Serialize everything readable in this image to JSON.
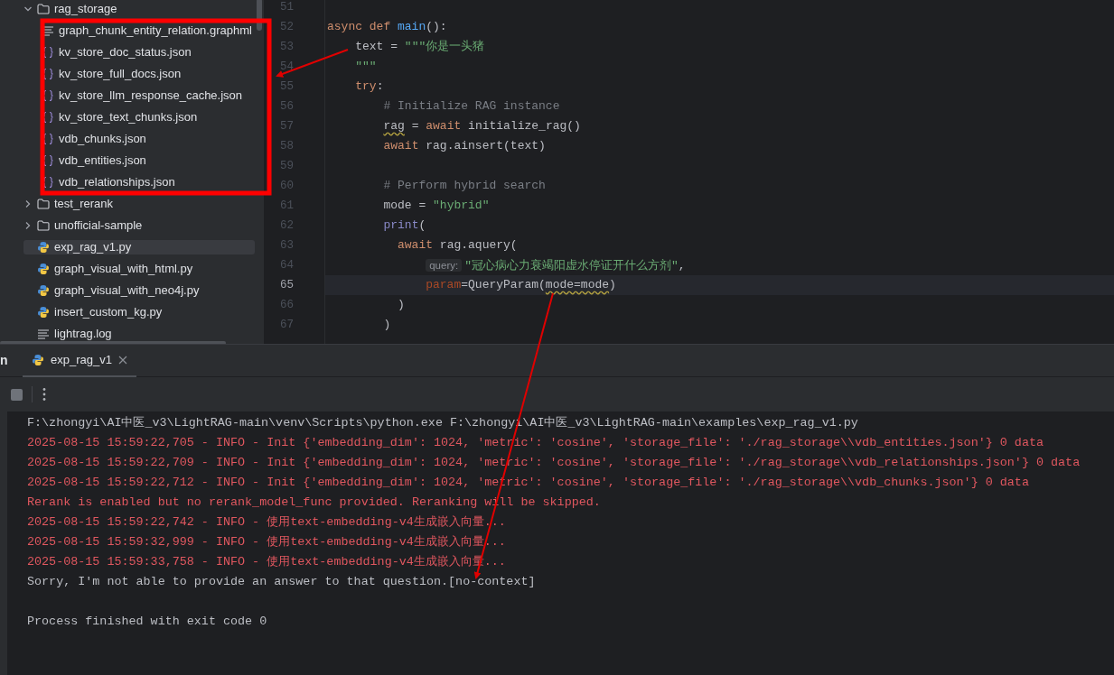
{
  "project_tree": [
    {
      "label": "rag_storage",
      "kind": "folder",
      "expanded": true,
      "selected": false,
      "children": [
        {
          "label": "graph_chunk_entity_relation.graphml",
          "kind": "text",
          "selected": false
        },
        {
          "label": "kv_store_doc_status.json",
          "kind": "json",
          "selected": false
        },
        {
          "label": "kv_store_full_docs.json",
          "kind": "json",
          "selected": false
        },
        {
          "label": "kv_store_llm_response_cache.json",
          "kind": "json",
          "selected": false
        },
        {
          "label": "kv_store_text_chunks.json",
          "kind": "json",
          "selected": false
        },
        {
          "label": "vdb_chunks.json",
          "kind": "json",
          "selected": false
        },
        {
          "label": "vdb_entities.json",
          "kind": "json",
          "selected": false
        },
        {
          "label": "vdb_relationships.json",
          "kind": "json",
          "selected": false
        }
      ]
    },
    {
      "label": "test_rerank",
      "kind": "folder",
      "expanded": false,
      "selected": false
    },
    {
      "label": "unofficial-sample",
      "kind": "folder",
      "expanded": false,
      "selected": false
    },
    {
      "label": "exp_rag_v1.py",
      "kind": "python",
      "selected": true
    },
    {
      "label": "graph_visual_with_html.py",
      "kind": "python",
      "selected": false
    },
    {
      "label": "graph_visual_with_neo4j.py",
      "kind": "python",
      "selected": false
    },
    {
      "label": "insert_custom_kg.py",
      "kind": "python",
      "selected": false
    },
    {
      "label": "lightrag.log",
      "kind": "text",
      "selected": false
    }
  ],
  "editor": {
    "lines": [
      {
        "number": "51",
        "current": false
      },
      {
        "number": "52",
        "current": false,
        "tokens": [
          {
            "kind": "keyword",
            "text": "async def "
          },
          {
            "kind": "function",
            "text": "main"
          },
          {
            "kind": "plain",
            "text": "():"
          }
        ]
      },
      {
        "number": "53",
        "current": false,
        "tokens": [
          {
            "kind": "plain",
            "text": "    text = "
          },
          {
            "kind": "string",
            "text": "\"\"\"你是一头猪"
          }
        ]
      },
      {
        "number": "54",
        "current": false,
        "tokens": [
          {
            "kind": "string",
            "text": "    \"\"\""
          }
        ]
      },
      {
        "number": "55",
        "current": false,
        "tokens": [
          {
            "kind": "keyword",
            "text": "    try"
          },
          {
            "kind": "plain",
            "text": ":"
          }
        ]
      },
      {
        "number": "56",
        "current": false,
        "tokens": [
          {
            "kind": "comment",
            "text": "        # Initialize RAG instance"
          }
        ]
      },
      {
        "number": "57",
        "current": false,
        "tokens": [
          {
            "kind": "plain",
            "text": "        rag",
            "warning": true
          },
          {
            "kind": "plain",
            "text": " = "
          },
          {
            "kind": "keyword",
            "text": "await"
          },
          {
            "kind": "plain",
            "text": " initialize_rag()"
          }
        ]
      },
      {
        "number": "58",
        "current": false,
        "tokens": [
          {
            "kind": "keyword",
            "text": "        await"
          },
          {
            "kind": "plain",
            "text": " rag.ainsert(text)"
          }
        ]
      },
      {
        "number": "59",
        "current": false
      },
      {
        "number": "60",
        "current": false,
        "tokens": [
          {
            "kind": "comment",
            "text": "        # Perform hybrid search"
          }
        ]
      },
      {
        "number": "61",
        "current": false,
        "tokens": [
          {
            "kind": "plain",
            "text": "        mode = "
          },
          {
            "kind": "string",
            "text": "\"hybrid\""
          }
        ]
      },
      {
        "number": "62",
        "current": false,
        "tokens": [
          {
            "kind": "builtin",
            "text": "        print"
          },
          {
            "kind": "plain",
            "text": "("
          }
        ]
      },
      {
        "number": "63",
        "current": false,
        "tokens": [
          {
            "kind": "keyword",
            "text": "          await"
          },
          {
            "kind": "plain",
            "text": " rag.aquery("
          }
        ]
      },
      {
        "number": "64",
        "current": false,
        "tokens": [
          {
            "kind": "hint",
            "text": "              query:"
          },
          {
            "kind": "string",
            "text": "\"冠心病心力衰竭阳虚水停证开什么方剂\""
          },
          {
            "kind": "plain",
            "text": ","
          }
        ]
      },
      {
        "number": "65",
        "current": true,
        "tokens": [
          {
            "kind": "param",
            "text": "              param"
          },
          {
            "kind": "plain",
            "text": "=QueryParam("
          },
          {
            "kind": "plain",
            "text": "mode=mode",
            "warning": true
          },
          {
            "kind": "plain",
            "text": ")"
          }
        ]
      },
      {
        "number": "66",
        "current": false,
        "tokens": [
          {
            "kind": "plain",
            "text": "          )"
          }
        ]
      },
      {
        "number": "67",
        "current": false,
        "tokens": [
          {
            "kind": "plain",
            "text": "        )"
          }
        ]
      }
    ]
  },
  "run_panel": {
    "title": "n",
    "tabs": [
      {
        "label": "exp_rag_v1",
        "selected": true
      }
    ],
    "console_lines": [
      {
        "kind": "command",
        "text": "F:\\zhongyi\\AI中医_v3\\LightRAG-main\\venv\\Scripts\\python.exe F:\\zhongyi\\AI中医_v3\\LightRAG-main\\examples\\exp_rag_v1.py"
      },
      {
        "kind": "log",
        "text": "2025-08-15 15:59:22,705 - INFO - Init {'embedding_dim': 1024, 'metric': 'cosine', 'storage_file': './rag_storage\\\\vdb_entities.json'} 0 data"
      },
      {
        "kind": "log",
        "text": "2025-08-15 15:59:22,709 - INFO - Init {'embedding_dim': 1024, 'metric': 'cosine', 'storage_file': './rag_storage\\\\vdb_relationships.json'} 0 data"
      },
      {
        "kind": "log",
        "text": "2025-08-15 15:59:22,712 - INFO - Init {'embedding_dim': 1024, 'metric': 'cosine', 'storage_file': './rag_storage\\\\vdb_chunks.json'} 0 data"
      },
      {
        "kind": "log",
        "text": "Rerank is enabled but no rerank_model_func provided. Reranking will be skipped."
      },
      {
        "kind": "log",
        "text": "2025-08-15 15:59:22,742 - INFO - 使用text-embedding-v4生成嵌入向量..."
      },
      {
        "kind": "log",
        "text": "2025-08-15 15:59:32,999 - INFO - 使用text-embedding-v4生成嵌入向量..."
      },
      {
        "kind": "log",
        "text": "2025-08-15 15:59:33,758 - INFO - 使用text-embedding-v4生成嵌入向量..."
      },
      {
        "kind": "output",
        "text": "Sorry, I'm not able to provide an answer to that question.[no-context]"
      },
      {
        "kind": "exit",
        "text": "Process finished with exit code 0"
      }
    ]
  }
}
